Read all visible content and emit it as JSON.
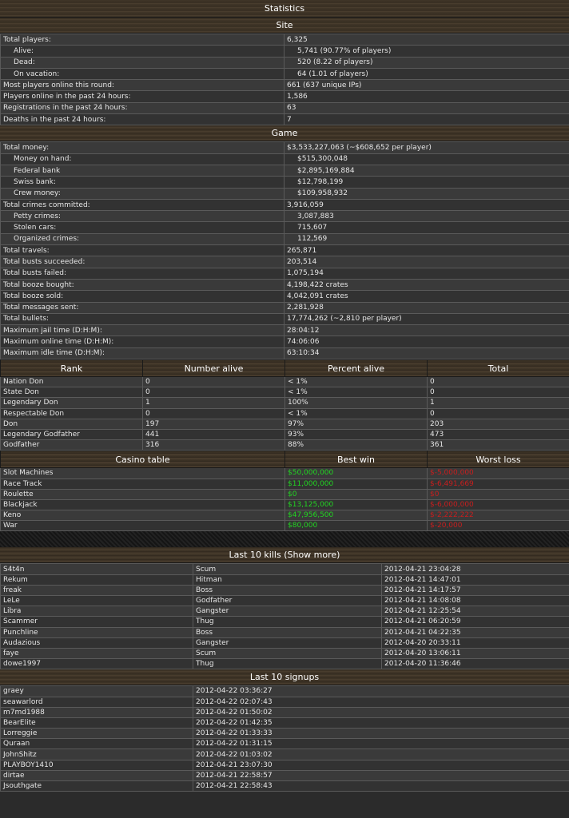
{
  "title": "Statistics",
  "site": {
    "header": "Site",
    "rows": [
      {
        "label": "Total players:",
        "value": "6,325",
        "indent": false
      },
      {
        "label": "Alive:",
        "value": "5,741 (90.77% of players)",
        "indent": true
      },
      {
        "label": "Dead:",
        "value": "520 (8.22 of players)",
        "indent": true
      },
      {
        "label": "On vacation:",
        "value": "64 (1.01 of players)",
        "indent": true
      },
      {
        "label": "Most players online this round:",
        "value": "661 (637 unique IPs)",
        "indent": false
      },
      {
        "label": "Players online in the past 24 hours:",
        "value": "1,586",
        "indent": false
      },
      {
        "label": "Registrations in the past 24 hours:",
        "value": "63",
        "indent": false
      },
      {
        "label": "Deaths in the past 24 hours:",
        "value": "7",
        "indent": false
      }
    ]
  },
  "game": {
    "header": "Game",
    "rows": [
      {
        "label": "Total money:",
        "value": "$3,533,227,063 (~$608,652 per player)",
        "indent": false
      },
      {
        "label": "Money on hand:",
        "value": "$515,300,048",
        "indent": true
      },
      {
        "label": "Federal bank",
        "value": "$2,895,169,884",
        "indent": true
      },
      {
        "label": "Swiss bank:",
        "value": "$12,798,199",
        "indent": true
      },
      {
        "label": "Crew money:",
        "value": "$109,958,932",
        "indent": true
      },
      {
        "label": "Total crimes committed:",
        "value": "3,916,059",
        "indent": false
      },
      {
        "label": "Petty crimes:",
        "value": "3,087,883",
        "indent": true
      },
      {
        "label": "Stolen cars:",
        "value": "715,607",
        "indent": true
      },
      {
        "label": "Organized crimes:",
        "value": "112,569",
        "indent": true
      },
      {
        "label": "Total travels:",
        "value": "265,871",
        "indent": false
      },
      {
        "label": "Total busts succeeded:",
        "value": "203,514",
        "indent": false
      },
      {
        "label": "Total busts failed:",
        "value": "1,075,194",
        "indent": false
      },
      {
        "label": "Total booze bought:",
        "value": "4,198,422 crates",
        "indent": false
      },
      {
        "label": "Total booze sold:",
        "value": "4,042,091 crates",
        "indent": false
      },
      {
        "label": "Total messages sent:",
        "value": "2,281,928",
        "indent": false
      },
      {
        "label": "Total bullets:",
        "value": "17,774,262 (~2,810 per player)",
        "indent": false
      },
      {
        "label": "Maximum jail time (D:H:M):",
        "value": "28:04:12",
        "indent": false
      },
      {
        "label": "Maximum online time (D:H:M):",
        "value": "74:06:06",
        "indent": false
      },
      {
        "label": "Maximum idle time (D:H:M):",
        "value": "63:10:34",
        "indent": false
      }
    ]
  },
  "ranks": {
    "headers": [
      "Rank",
      "Number alive",
      "Percent alive",
      "Total"
    ],
    "rows": [
      [
        "Nation Don",
        "0",
        "< 1%",
        "0"
      ],
      [
        "State Don",
        "0",
        "< 1%",
        "0"
      ],
      [
        "Legendary Don",
        "1",
        "100%",
        "1"
      ],
      [
        "Respectable Don",
        "0",
        "< 1%",
        "0"
      ],
      [
        "Don",
        "197",
        "97%",
        "203"
      ],
      [
        "Legendary Godfather",
        "441",
        "93%",
        "473"
      ],
      [
        "Godfather",
        "316",
        "88%",
        "361"
      ]
    ]
  },
  "casino": {
    "headers": [
      "Casino table",
      "Best win",
      "Worst loss"
    ],
    "rows": [
      [
        "Slot Machines",
        "$50,000,000",
        "$-5,000,000"
      ],
      [
        "Race Track",
        "$11,000,000",
        "$-6,491,669"
      ],
      [
        "Roulette",
        "$0",
        "$0"
      ],
      [
        "Blackjack",
        "$13,125,000",
        "$-6,000,000"
      ],
      [
        "Keno",
        "$47,956,500",
        "$-2,222,222"
      ],
      [
        "War",
        "$80,000",
        "$-20,000"
      ]
    ],
    "colors": {
      "win": "#22d422",
      "loss": "#c81e1e"
    }
  },
  "kills": {
    "header": "Last 10 kills (Show more)",
    "rows": [
      [
        "S4t4n",
        "Scum",
        "2012-04-21 23:04:28"
      ],
      [
        "Rekum",
        "Hitman",
        "2012-04-21 14:47:01"
      ],
      [
        "freak",
        "Boss",
        "2012-04-21 14:17:57"
      ],
      [
        "LeLe",
        "Godfather",
        "2012-04-21 14:08:08"
      ],
      [
        "Libra",
        "Gangster",
        "2012-04-21 12:25:54"
      ],
      [
        "Scammer",
        "Thug",
        "2012-04-21 06:20:59"
      ],
      [
        "Punchline",
        "Boss",
        "2012-04-21 04:22:35"
      ],
      [
        "Audazious",
        "Gangster",
        "2012-04-20 20:33:11"
      ],
      [
        "faye",
        "Scum",
        "2012-04-20 13:06:11"
      ],
      [
        "dowe1997",
        "Thug",
        "2012-04-20 11:36:46"
      ]
    ]
  },
  "signups": {
    "header": "Last 10 signups",
    "rows": [
      [
        "graey",
        "2012-04-22 03:36:27"
      ],
      [
        "seawarlord",
        "2012-04-22 02:07:43"
      ],
      [
        "m7md1988",
        "2012-04-22 01:50:02"
      ],
      [
        "BearElite",
        "2012-04-22 01:42:35"
      ],
      [
        "Lorreggie",
        "2012-04-22 01:33:33"
      ],
      [
        "Quraan",
        "2012-04-22 01:31:15"
      ],
      [
        "JohnShitz",
        "2012-04-22 01:03:02"
      ],
      [
        "PLAYBOY1410",
        "2012-04-21 23:07:30"
      ],
      [
        "dirtae",
        "2012-04-21 22:58:57"
      ],
      [
        "Jsouthgate",
        "2012-04-21 22:58:43"
      ]
    ]
  }
}
